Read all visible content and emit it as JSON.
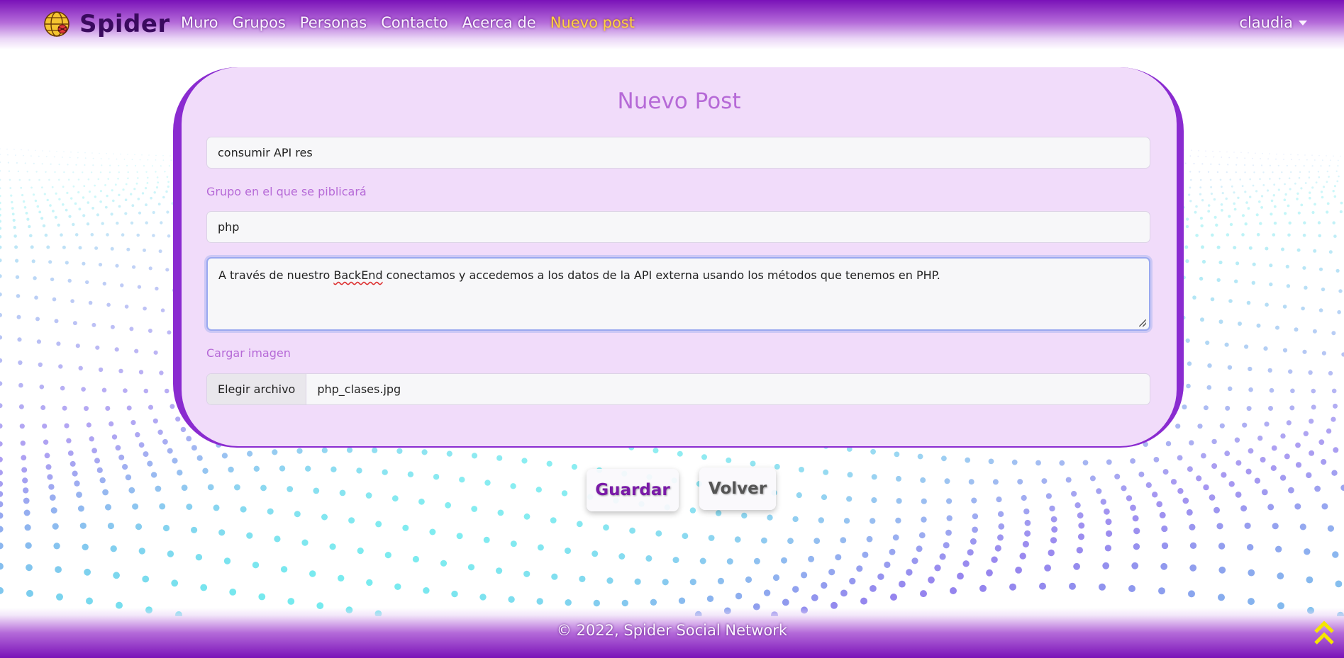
{
  "navbar": {
    "brand": "Spider",
    "links": [
      {
        "label": "Muro",
        "active": false
      },
      {
        "label": "Grupos",
        "active": false
      },
      {
        "label": "Personas",
        "active": false
      },
      {
        "label": "Contacto",
        "active": false
      },
      {
        "label": "Acerca de",
        "active": false
      },
      {
        "label": "Nuevo post",
        "active": true
      }
    ],
    "user": "claudia"
  },
  "form": {
    "title": "Nuevo Post",
    "post_title_value": "consumir API res",
    "group_label": "Grupo en el que se piblicará",
    "group_value": "php",
    "body_before_spell": "A través de nuestro ",
    "body_spell_word": "BackEnd",
    "body_after_spell": " conectamos y accedemos a los datos de la API externa usando los métodos que tenemos en PHP.",
    "image_label": "Cargar imagen",
    "file_button": "Elegir archivo",
    "file_name": "php_clases.jpg"
  },
  "actions": {
    "save": "Guardar",
    "back": "Volver"
  },
  "footer": {
    "text": "© 2022, Spider Social Network"
  },
  "colors": {
    "accent_purple": "#7a12b8",
    "card_bg": "#f1dcfa",
    "label_purple": "#b66ad7",
    "active_link": "#ffd23f"
  },
  "icons": {
    "brand": "globe-spider-icon",
    "user_menu": "caret-down-icon",
    "scroll_top": "double-chevron-up-icon"
  }
}
